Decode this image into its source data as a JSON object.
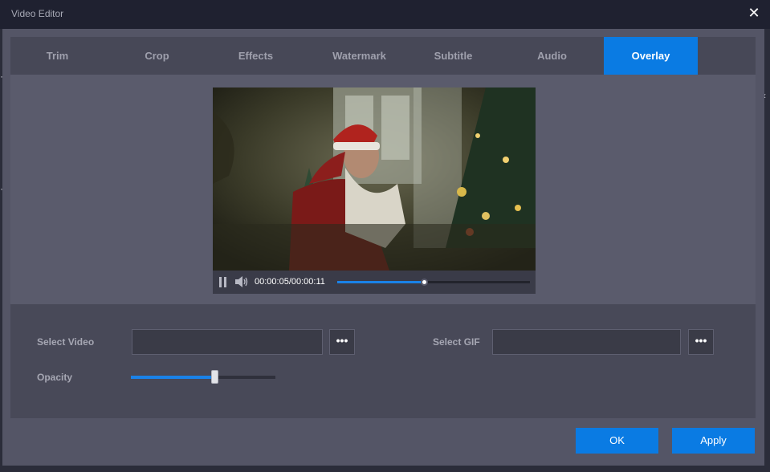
{
  "window": {
    "title": "Video Editor"
  },
  "tabs": [
    {
      "label": "Trim"
    },
    {
      "label": "Crop"
    },
    {
      "label": "Effects"
    },
    {
      "label": "Watermark"
    },
    {
      "label": "Subtitle"
    },
    {
      "label": "Audio"
    },
    {
      "label": "Overlay",
      "active": true
    }
  ],
  "player": {
    "time_display": "00:00:05/00:00:11",
    "progress": 0.45
  },
  "overlay": {
    "select_video_label": "Select Video",
    "select_video_value": "",
    "select_gif_label": "Select GIF",
    "select_gif_value": "",
    "browse_label": "•••",
    "opacity_label": "Opacity",
    "opacity_value": 0.58
  },
  "footer": {
    "ok_label": "OK",
    "apply_label": "Apply"
  },
  "colors": {
    "accent": "#0a7be3",
    "background": "#545566",
    "titlebar": "#1f2130"
  }
}
